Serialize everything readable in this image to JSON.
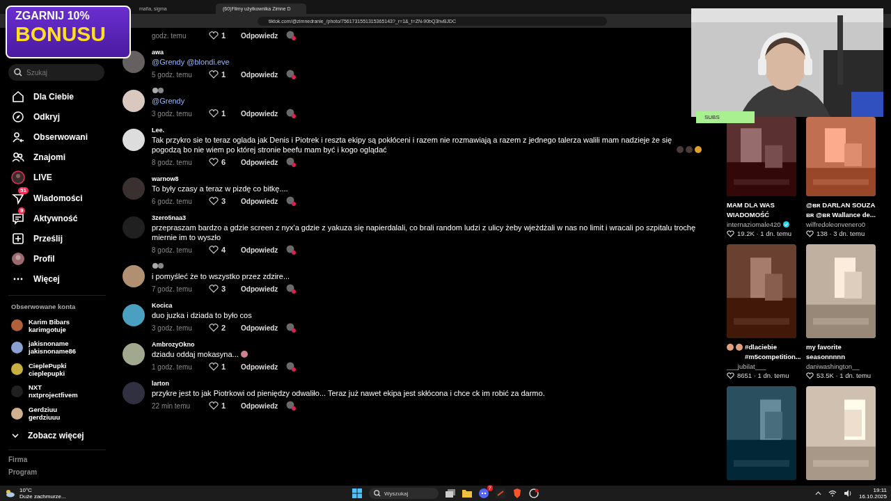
{
  "browser": {
    "tabs": [
      {
        "title": "mafia, sigma",
        "selected": false
      },
      {
        "title": "(60)Filmy użytkownika Zimne D",
        "selected": true
      }
    ],
    "url": "tiktok.com/@zimnedranie_/photo/7561731551315365143?_r=1&_t=ZN-90bQ3hvBJDC"
  },
  "promo": {
    "line_1": "ZGARNIJ 10%",
    "line_2": "BONUSU"
  },
  "webcam": {
    "label": "SUBS"
  },
  "sidebar": {
    "search": {
      "placeholder": "Szukaj"
    },
    "nav": [
      {
        "kind": "home",
        "label": "Dla Ciebie"
      },
      {
        "kind": "compass",
        "label": "Odkryj"
      },
      {
        "kind": "following",
        "label": "Obserwowani"
      },
      {
        "kind": "friends",
        "label": "Znajomi"
      },
      {
        "kind": "live",
        "label": "LIVE"
      },
      {
        "kind": "messages",
        "label": "Wiadomości",
        "badge": "51"
      },
      {
        "kind": "activity",
        "label": "Aktywność",
        "badge": "9"
      },
      {
        "kind": "upload",
        "label": "Prześlij"
      },
      {
        "kind": "profile",
        "label": "Profil"
      },
      {
        "kind": "more",
        "label": "Więcej"
      }
    ],
    "following_heading": "Obserwowane konta",
    "following": [
      {
        "name": "Karim Bibars",
        "handle": "karimgotuje",
        "color": "#b0603a"
      },
      {
        "name": "jakisnoname",
        "handle": "jakisnoname86",
        "color": "#8aa0d0"
      },
      {
        "name": "CieplePupki",
        "handle": "cieplepupki",
        "color": "#c8b040"
      },
      {
        "name": "NXT",
        "handle": "nxtprojectfivem",
        "color": "#202020"
      },
      {
        "name": "Gerdziuu",
        "handle": "gerdziuuu",
        "color": "#d0b090"
      }
    ],
    "see_more": "Zobacz więcej",
    "footer": [
      "Firma",
      "Program"
    ]
  },
  "comments": [
    {
      "time": "godz. temu",
      "likes": "1",
      "reply": "Odpowiedz"
    },
    {
      "user": "awa",
      "text": "@Grendy @blondi.eve",
      "kind": "mention",
      "time": "5 godz. temu",
      "likes": "1",
      "reply": "Odpowiedz"
    },
    {
      "text": "@Grendy",
      "kind": "mention",
      "time": "3 godz. temu",
      "likes": "1",
      "reply": "Odpowiedz"
    },
    {
      "user": "Lee.",
      "text": "Tak przykro sie to teraz oglada jak Denis i Piotrek i reszta ekipy są pokłóceni i razem nie rozmawiają a razem z jednego talerza walili mam nadzieje że się pogodzą bo nie wiem po której stronie beefu mam być i kogo oglądać",
      "emojis": [
        {
          "kind": "dark"
        },
        {
          "kind": "dark"
        },
        {
          "kind": "smile"
        }
      ],
      "time": "8 godz. temu",
      "likes": "6",
      "reply": "Odpowiedz"
    },
    {
      "user": "warnow8",
      "text": "To były czasy a teraz w pizdę co bitkę....",
      "time": "6 godz. temu",
      "likes": "3",
      "reply": "Odpowiedz"
    },
    {
      "user": "3zero5naa3",
      "text": "przepraszam bardzo a gdzie screen z nyx'a gdzie z yakuza się napierdalali, co brali random ludzi z ulicy żeby wjeżdżali w nas no limit i wracali po szpitalu trochę miernie im to wyszło",
      "time": "8 godz. temu",
      "likes": "4",
      "reply": "Odpowiedz"
    },
    {
      "text": "i pomyśleć że to wszystko przez zdzire...",
      "time": "7 godz. temu",
      "likes": "3",
      "reply": "Odpowiedz"
    },
    {
      "user": "Kocica",
      "text": "duo juzka i dziada to było cos",
      "time": "3 godz. temu",
      "likes": "2",
      "reply": "Odpowiedz"
    },
    {
      "user": "AmbrozyOkno",
      "text": "dziadu oddaj mokasyna...",
      "emojis": [
        {
          "kind": "crying"
        }
      ],
      "time": "1 godz. temu",
      "likes": "1",
      "reply": "Odpowiedz"
    },
    {
      "user": "larton",
      "text": "przykre jest to jak Piotrkowi od pieniędzy odwaliło... Teraz już nawet ekipa jest skłócona i chce ck im robić za darmo.",
      "time": "22 min temu",
      "likes": "1",
      "reply": "Odpowiedz"
    }
  ],
  "videos": [
    {
      "kind": "picture",
      "title": "MAM DLA WAS WIADOMOŚĆ",
      "author": "internaziomale420",
      "verified": true,
      "stats": "19.2K · 1 dn. temu"
    },
    {
      "kind": "picture",
      "title": "@ʙʀ DARLAN SOUZA ʙʀ @ʙʀ Wallance de...",
      "author": "wilfredoleonvenero0",
      "verified": false,
      "stats": "138 · 3 dn. temu"
    },
    {
      "kind": "picture",
      "title": "#dlaciebie #m5competition...",
      "emojis": [
        {
          "kind": "face"
        },
        {
          "kind": "face"
        }
      ],
      "author": "___jubilat___",
      "verified": false,
      "stats": "8651 · 1 dn. temu"
    },
    {
      "kind": "picture",
      "title": "my favorite seasonnnnn",
      "author": "daniwashington__",
      "verified": false,
      "stats": "53.5K · 1 dn. temu"
    },
    {
      "kind": "picture"
    },
    {
      "kind": "picture"
    }
  ],
  "taskbar": {
    "weather": {
      "temp": "10°C",
      "desc": "Duże zachmurze..."
    },
    "search": {
      "placeholder": "Wyszukaj"
    },
    "discord_badge": "7",
    "time": "19:11",
    "date": "16.10.2025"
  }
}
